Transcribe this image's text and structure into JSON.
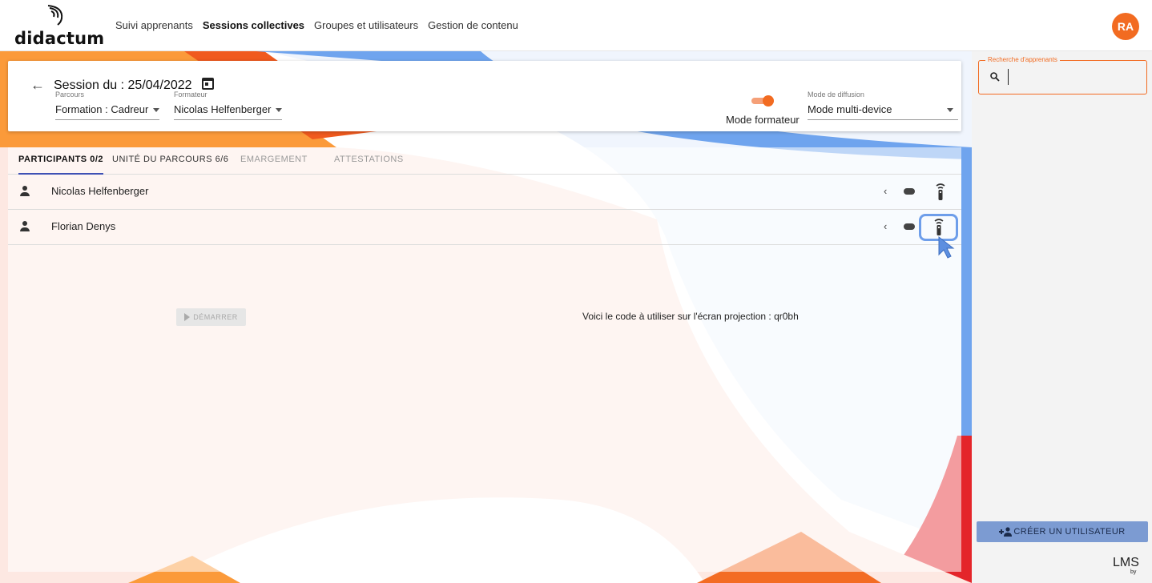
{
  "brand": {
    "name": "didactum"
  },
  "nav": [
    {
      "label": "Suivi apprenants",
      "active": false
    },
    {
      "label": "Sessions collectives",
      "active": true
    },
    {
      "label": "Groupes et utilisateurs",
      "active": false
    },
    {
      "label": "Gestion de contenu",
      "active": false
    }
  ],
  "user": {
    "initials": "RA"
  },
  "session": {
    "title": "Session du : 25/04/2022",
    "parcours_label": "Parcours",
    "parcours_value": "Formation : Cadreur",
    "formateur_label": "Formateur",
    "formateur_value": "Nicolas Helfenberger",
    "mode_formateur_label": "Mode formateur",
    "mode_formateur_on": true,
    "diffusion_label": "Mode de diffusion",
    "diffusion_value": "Mode multi-device"
  },
  "tabs": [
    {
      "label": "PARTICIPANTS 0/2",
      "state": "active"
    },
    {
      "label": "UNITÉ DU PARCOURS 6/6",
      "state": "normal"
    },
    {
      "label": "EMARGEMENT",
      "state": "muted"
    },
    {
      "label": "ATTESTATIONS",
      "state": "muted"
    }
  ],
  "participants": [
    {
      "name": "Nicolas Helfenberger"
    },
    {
      "name": "Florian Denys"
    }
  ],
  "start_button": "DÉMARRER",
  "code_message": "Voici le code à utiliser sur l'écran projection : qr0bh",
  "search": {
    "label": "Recherche d'apprenants",
    "value": "",
    "placeholder": ""
  },
  "create_user_button": "CRÉER UN UTILISATEUR",
  "footer": {
    "lms": "LMS",
    "by": "by"
  },
  "colors": {
    "accent": "#f26b21",
    "primary_button": "#7c9bd2",
    "tab_indicator": "#3f51b5",
    "highlight": "#6e9eea"
  }
}
